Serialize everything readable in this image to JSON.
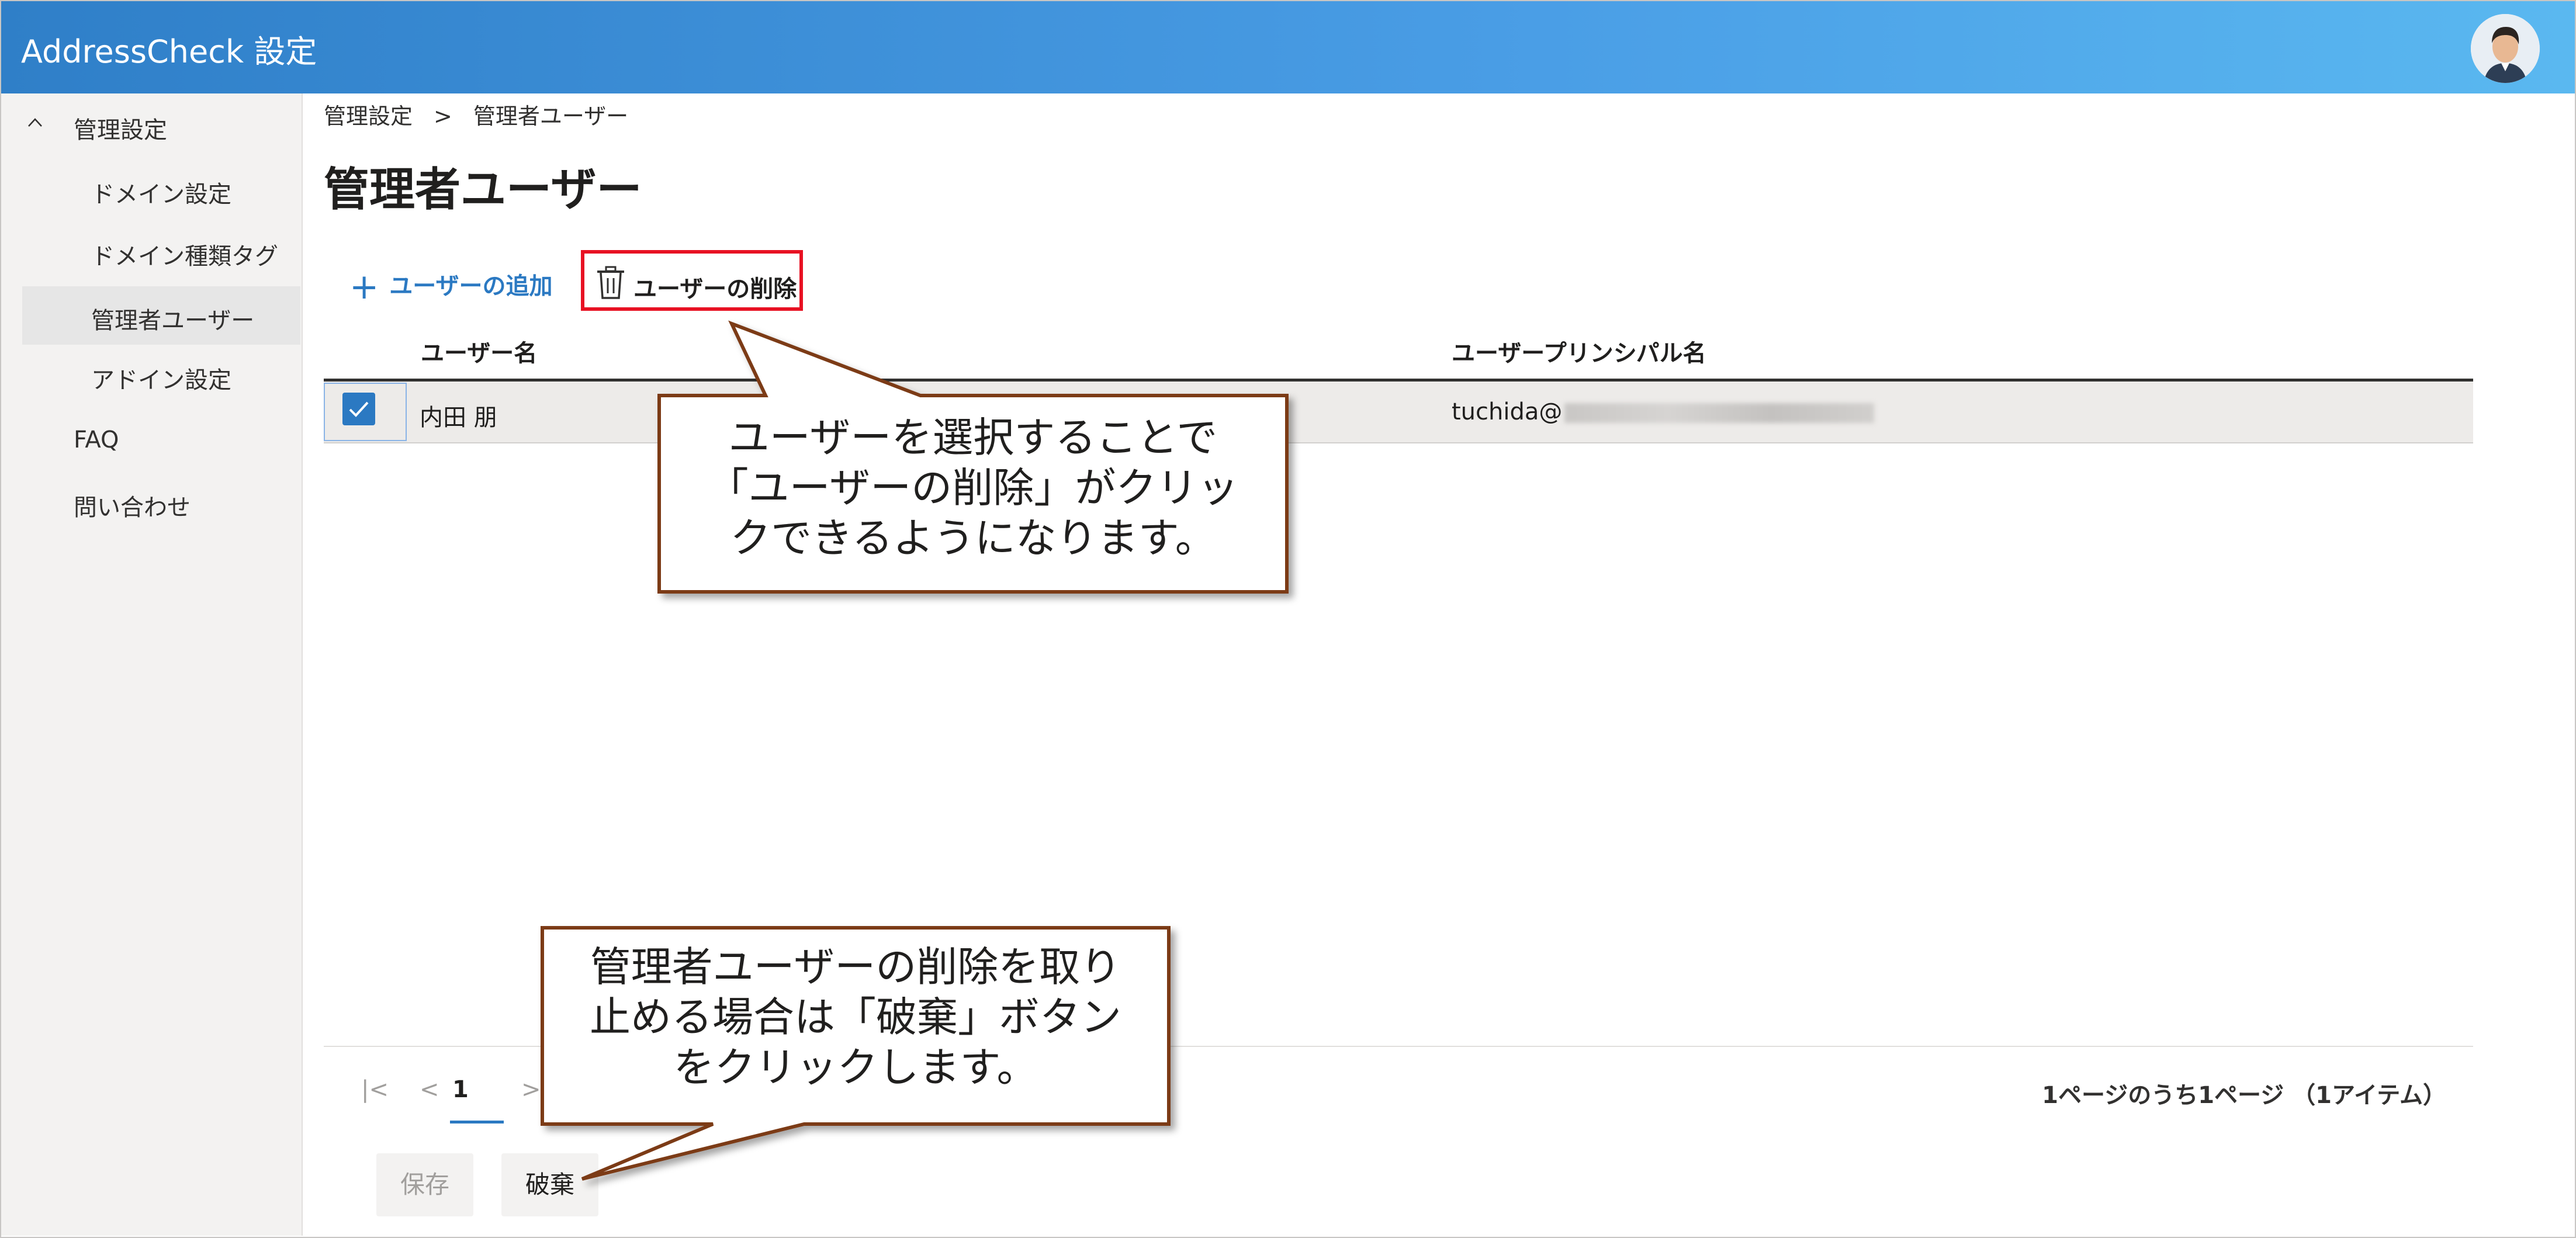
{
  "app": {
    "title": "AddressCheck 設定"
  },
  "sidebar": {
    "items": [
      {
        "label": "管理設定",
        "icon": "chevron-up-icon"
      },
      {
        "label": "ドメイン設定"
      },
      {
        "label": "ドメイン種類タグ"
      },
      {
        "label": "管理者ユーザー"
      },
      {
        "label": "アドイン設定"
      },
      {
        "label": "FAQ"
      },
      {
        "label": "問い合わせ"
      }
    ]
  },
  "breadcrumb": {
    "parent": "管理設定",
    "separator": ">",
    "current": "管理者ユーザー"
  },
  "page": {
    "title": "管理者ユーザー"
  },
  "commands": {
    "add": "ユーザーの追加",
    "delete": "ユーザーの削除"
  },
  "table": {
    "columns": [
      "ユーザー名",
      "ユーザープリンシパル名"
    ],
    "rows": [
      {
        "name": "内田 朋",
        "upn_prefix": "tuchida@",
        "checked": true
      }
    ]
  },
  "pager": {
    "current": "1",
    "info": "1ページのうち1ページ （1アイテム）"
  },
  "buttons": {
    "save": "保存",
    "discard": "破棄"
  },
  "callouts": {
    "delete_hint": [
      "ユーザーを選択することで",
      "「ユーザーの削除」がクリッ",
      "クできるようになります。"
    ],
    "discard_hint": [
      "管理者ユーザーの削除を取り",
      "止める場合は「破棄」ボタン",
      "をクリックします。"
    ]
  },
  "colors": {
    "accent": "#2b79c2",
    "highlight": "#e81123",
    "callout_border": "#7b3a18"
  }
}
